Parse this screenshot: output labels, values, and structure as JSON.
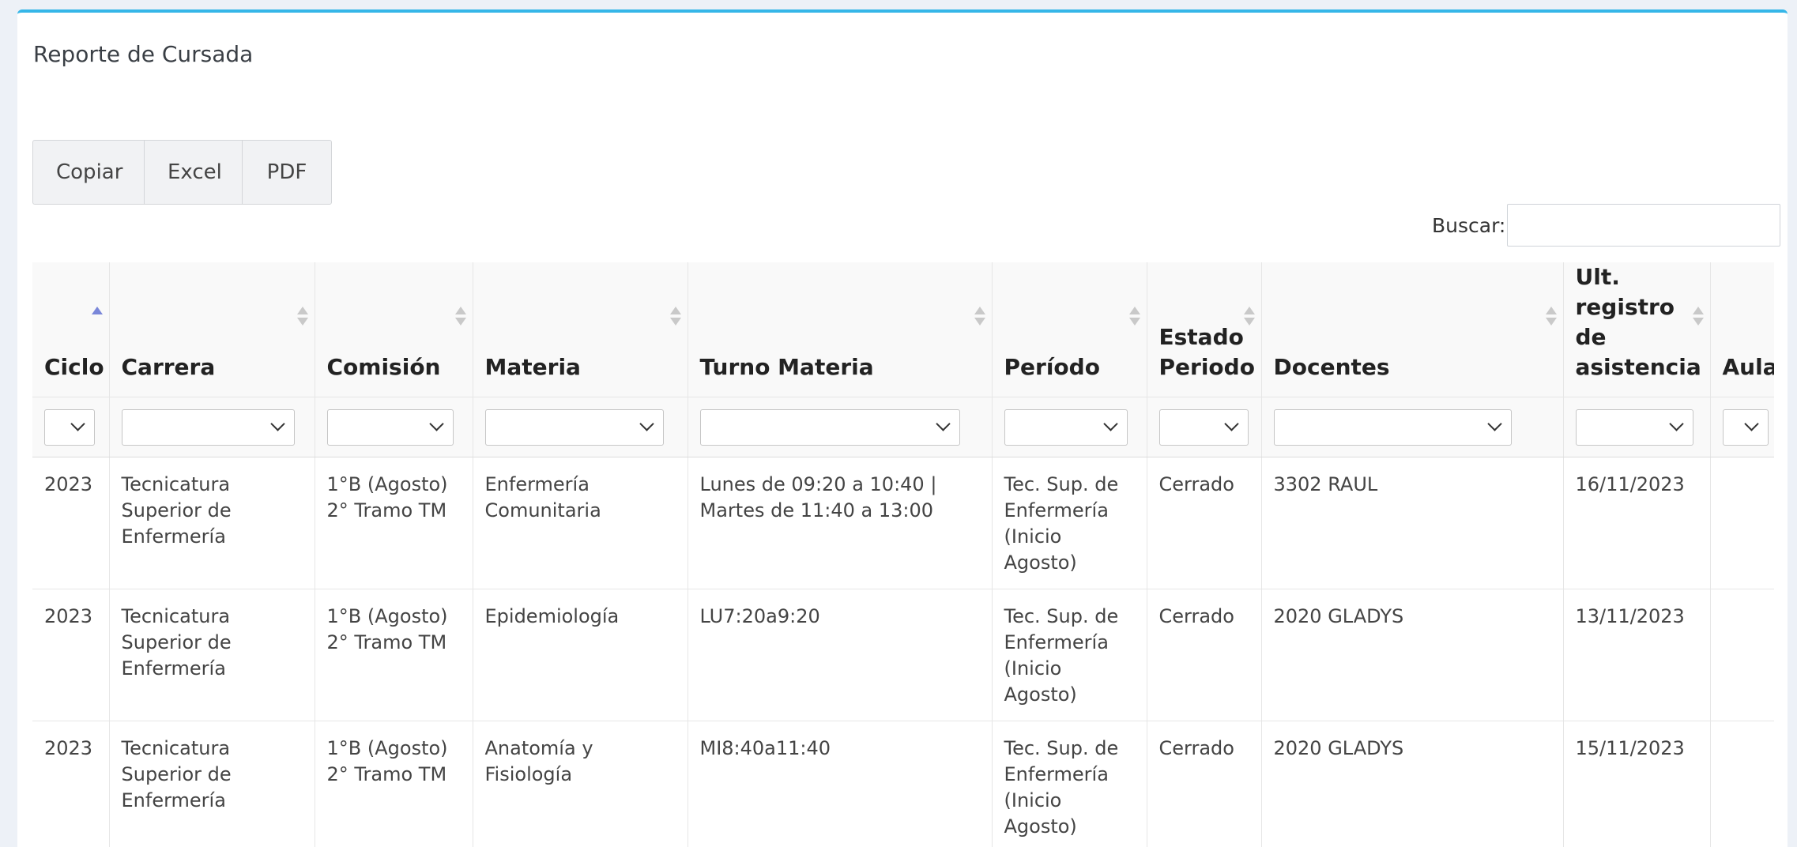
{
  "page": {
    "title": "Reporte de Cursada"
  },
  "toolbar": {
    "copy_label": "Copiar",
    "excel_label": "Excel",
    "pdf_label": "PDF"
  },
  "search": {
    "label": "Buscar:",
    "value": ""
  },
  "table": {
    "columns": [
      "Ciclo",
      "Carrera",
      "Comisión",
      "Materia",
      "Turno Materia",
      "Período",
      "Estado Periodo",
      "Docentes",
      "Ult. registro de asistencia",
      "Aula"
    ],
    "rows": [
      [
        "2023",
        "Tecnicatura Superior de Enfermería",
        "1°B (Agosto) 2° Tramo TM",
        "Enfermería Comunitaria",
        "Lunes de 09:20 a 10:40 | Martes de 11:40 a 13:00",
        "Tec. Sup. de Enfermería (Inicio Agosto)",
        "Cerrado",
        "3302 RAUL",
        "16/11/2023",
        ""
      ],
      [
        "2023",
        "Tecnicatura Superior de Enfermería",
        "1°B (Agosto) 2° Tramo TM",
        "Epidemiología",
        "LU7:20a9:20",
        "Tec. Sup. de Enfermería (Inicio Agosto)",
        "Cerrado",
        "2020 GLADYS",
        "13/11/2023",
        ""
      ],
      [
        "2023",
        "Tecnicatura Superior de Enfermería",
        "1°B (Agosto) 2° Tramo TM",
        "Anatomía y Fisiología",
        "MI8:40a11:40",
        "Tec. Sup. de Enfermería (Inicio Agosto)",
        "Cerrado",
        "2020 GLADYS",
        "15/11/2023",
        ""
      ]
    ]
  },
  "colors": {
    "accent": "#35b6e8",
    "sort_active": "#7a87d9",
    "header_bg": "#f9f9f9"
  }
}
